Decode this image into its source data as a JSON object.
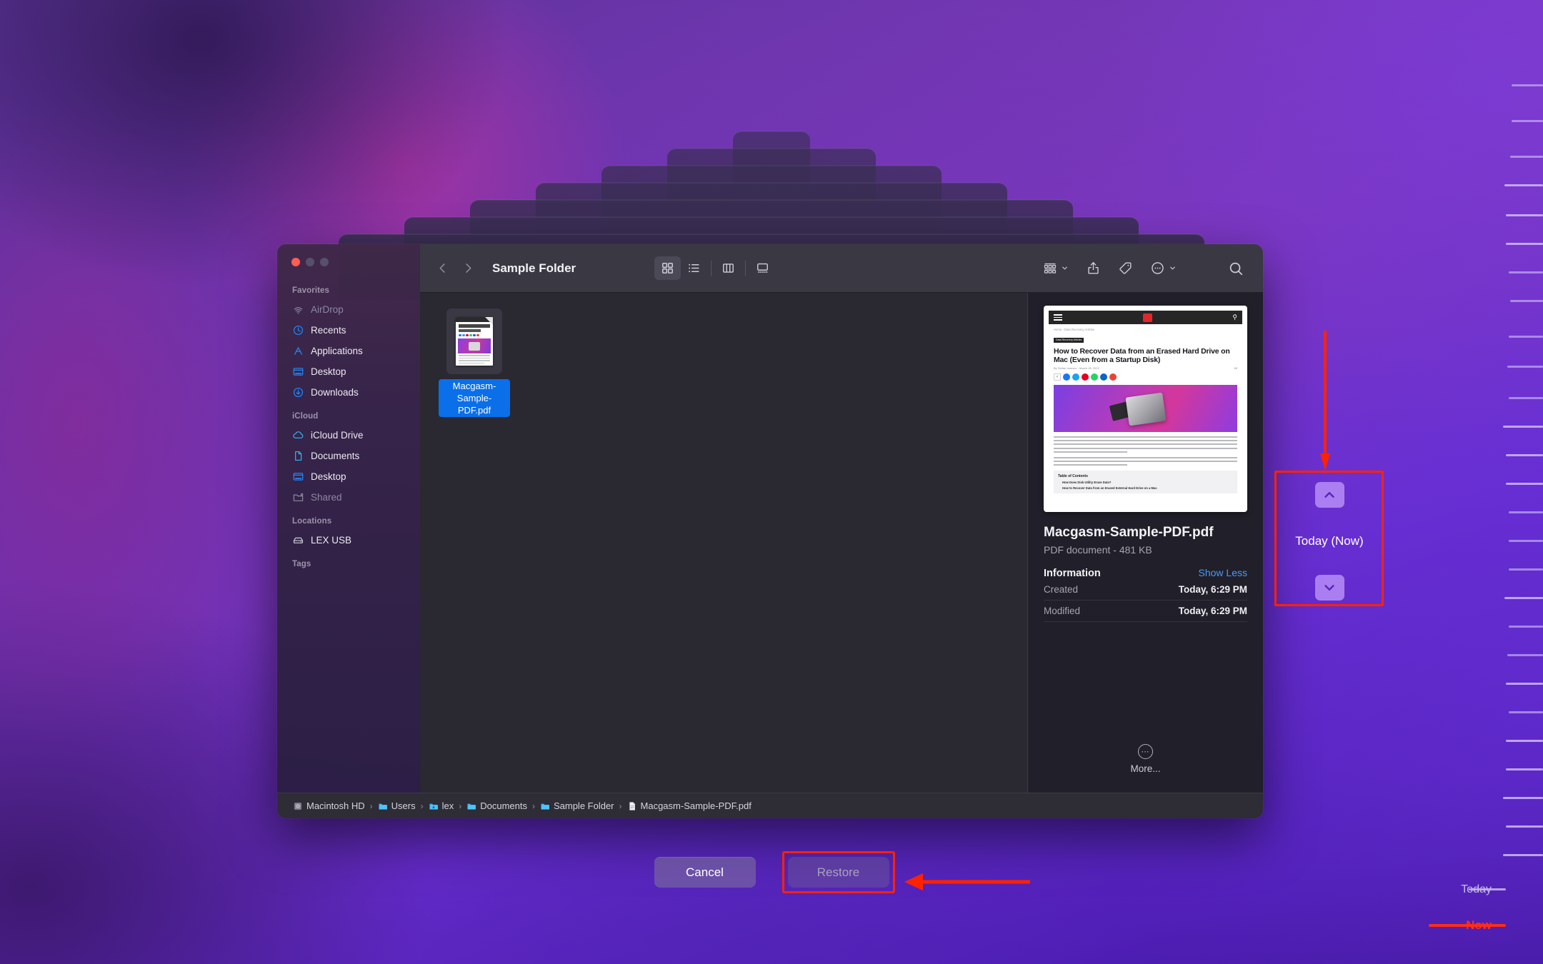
{
  "window": {
    "title": "Sample Folder",
    "traffic_lights": [
      "close",
      "minimize",
      "maximize"
    ]
  },
  "toolbar": {
    "back_icon": "chevron-left-icon",
    "forward_icon": "chevron-right-icon",
    "view_modes": [
      {
        "name": "icon-view",
        "icon": "grid-icon",
        "active": true
      },
      {
        "name": "list-view",
        "icon": "list-icon",
        "active": false
      },
      {
        "name": "column-view",
        "icon": "columns-icon",
        "active": false
      },
      {
        "name": "gallery-view",
        "icon": "gallery-icon",
        "active": false
      }
    ],
    "group_by_icon": "group-by-icon",
    "share_icon": "share-icon",
    "tag_icon": "tag-icon",
    "more_icon": "ellipsis-circle-icon",
    "search_icon": "search-icon"
  },
  "sidebar": {
    "groups": [
      {
        "title": "Favorites",
        "items": [
          {
            "label": "AirDrop",
            "icon": "airdrop-icon",
            "dim": true
          },
          {
            "label": "Recents",
            "icon": "clock-icon",
            "dim": false
          },
          {
            "label": "Applications",
            "icon": "applications-icon",
            "dim": false
          },
          {
            "label": "Desktop",
            "icon": "desktop-icon",
            "dim": false
          },
          {
            "label": "Downloads",
            "icon": "downloads-icon",
            "dim": false
          }
        ]
      },
      {
        "title": "iCloud",
        "items": [
          {
            "label": "iCloud Drive",
            "icon": "cloud-icon",
            "dim": false
          },
          {
            "label": "Documents",
            "icon": "document-icon",
            "dim": false
          },
          {
            "label": "Desktop",
            "icon": "desktop-icon",
            "dim": false
          },
          {
            "label": "Shared",
            "icon": "shared-folder-icon",
            "dim": true
          }
        ]
      },
      {
        "title": "Locations",
        "items": [
          {
            "label": "LEX USB",
            "icon": "external-drive-icon",
            "dim": false
          }
        ]
      },
      {
        "title": "Tags",
        "items": []
      }
    ]
  },
  "files": [
    {
      "name": "Macgasm-Sample-PDF.pdf",
      "selected": true,
      "icon": "pdf-document-icon"
    }
  ],
  "preview": {
    "file_name": "Macgasm-Sample-PDF.pdf",
    "kind_and_size": "PDF document - 481 KB",
    "information_label": "Information",
    "show_less_label": "Show Less",
    "rows": [
      {
        "key": "Created",
        "value": "Today, 6:29 PM"
      },
      {
        "key": "Modified",
        "value": "Today, 6:29 PM"
      }
    ],
    "more_label": "More...",
    "document": {
      "breadcrumb": "Home  ›  Data Recovery Articles",
      "category_tag": "Data Recovery Articles",
      "headline": "How to Recover Data from an Erased Hard Drive on Mac (Even from a Startup Disk)",
      "byline": "By Stefan Ionescu - March 28, 2022",
      "views": "68",
      "paragraph_1": "Accidentally erasing important files on your Mac is not necessarily a fatal mistake - although it can easily seem like one when it happens to you. As long as you didn't do a full format, and the disk is not physically damaged, there's a good chance you'll be able to recover an erased Mac hard drive - if not fully, then at least partially.",
      "paragraph_2": "There are various solutions on the market that can help you recover your data. Time Machine is built directly into your OS, and there are also tools like Disk Drill.",
      "toc_title": "Table of Contents",
      "toc_items": [
        "How Does Disk Utility Erase Data?",
        "How to Recover Data from an Erased External Hard Drive on a Mac"
      ]
    }
  },
  "path_bar": {
    "items": [
      {
        "label": "Macintosh HD",
        "icon": "hard-drive-icon"
      },
      {
        "label": "Users",
        "icon": "folder-icon"
      },
      {
        "label": "lex",
        "icon": "home-folder-icon"
      },
      {
        "label": "Documents",
        "icon": "folder-icon"
      },
      {
        "label": "Sample Folder",
        "icon": "folder-icon"
      },
      {
        "label": "Macgasm-Sample-PDF.pdf",
        "icon": "pdf-file-icon"
      }
    ],
    "separator": "›"
  },
  "actions": {
    "cancel_label": "Cancel",
    "restore_label": "Restore",
    "restore_disabled": true
  },
  "time_machine": {
    "snapshot_label": "Today (Now)",
    "up_arrow_icon": "chevron-up-icon",
    "down_arrow_icon": "chevron-down-icon",
    "timeline": {
      "today_label": "Today",
      "now_label": "Now"
    }
  },
  "annotations": {
    "highlight_color": "#ff2200",
    "boxes": [
      "time-machine-nav",
      "restore-button"
    ],
    "arrows": [
      "arrow-down-to-tm-nav",
      "arrow-left-to-restore"
    ]
  }
}
